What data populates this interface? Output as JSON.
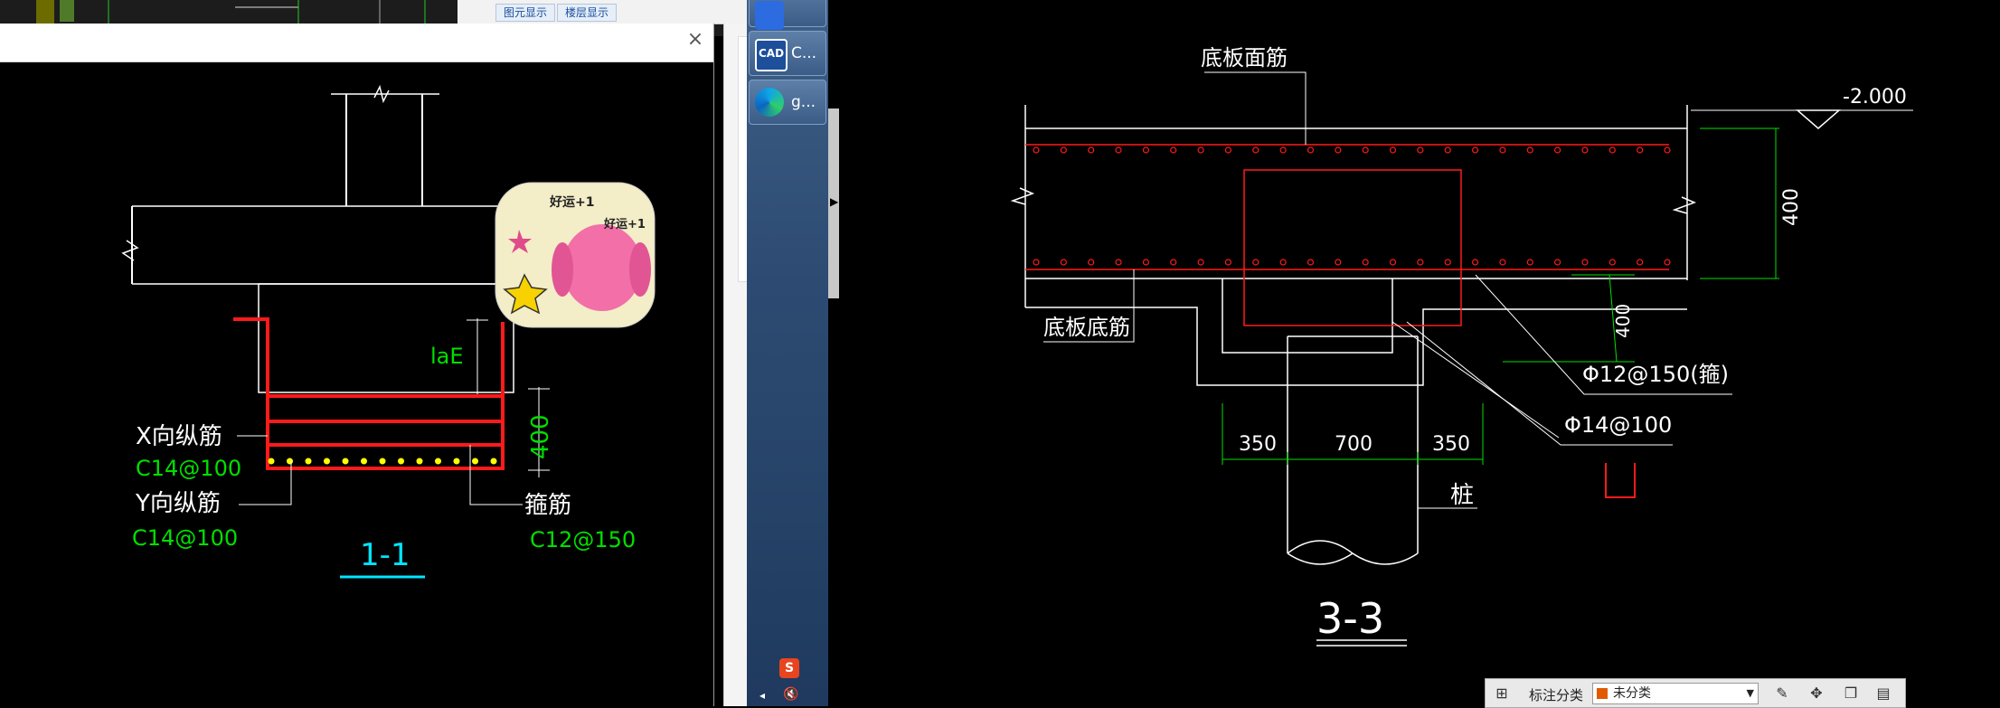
{
  "left_drawing": {
    "section_label": "1-1",
    "lae_label": "laE",
    "height_dim": "400",
    "x_bar_label": "X向纵筋",
    "x_bar_spec": "C14@100",
    "y_bar_label": "Y向纵筋",
    "y_bar_spec": "C14@100",
    "stirrup_label": "箍筋",
    "stirrup_spec": "C12@150"
  },
  "sticker": {
    "text_1": "好运+1",
    "text_2": "好运+1"
  },
  "top_tabs": [
    {
      "label": "图元显示"
    },
    {
      "label": "楼层显示"
    }
  ],
  "taskbar": {
    "items": [
      {
        "label": "",
        "icon": "app-icon"
      },
      {
        "label": "C...",
        "icon": "cad-icon"
      },
      {
        "label": "g...",
        "icon": "edge-icon"
      }
    ],
    "tray_icons": [
      "sogou-icon",
      "speaker-mute-icon"
    ]
  },
  "right_drawing": {
    "section_label": "3-3",
    "top_bar_label": "底板面筋",
    "bottom_bar_label": "底板底筋",
    "elevation": "-2.000",
    "depth_dim": "400",
    "pit_depth_dim": "400",
    "stirrup_spec": "Φ12@150(箍)",
    "bar_spec": "Φ14@100",
    "dim_left": "350",
    "dim_mid": "700",
    "dim_right": "350",
    "pile_label": "桩"
  },
  "status_bar": {
    "label": "标注分类",
    "selected": "未分类",
    "swatch_color": "#e05a00"
  },
  "colors": {
    "rebar_red": "#ff1a1a",
    "dim_green": "#00e000",
    "cad_white": "#ffffff",
    "section_cyan": "#00e5ff",
    "dot_yellow": "#ffff00"
  }
}
